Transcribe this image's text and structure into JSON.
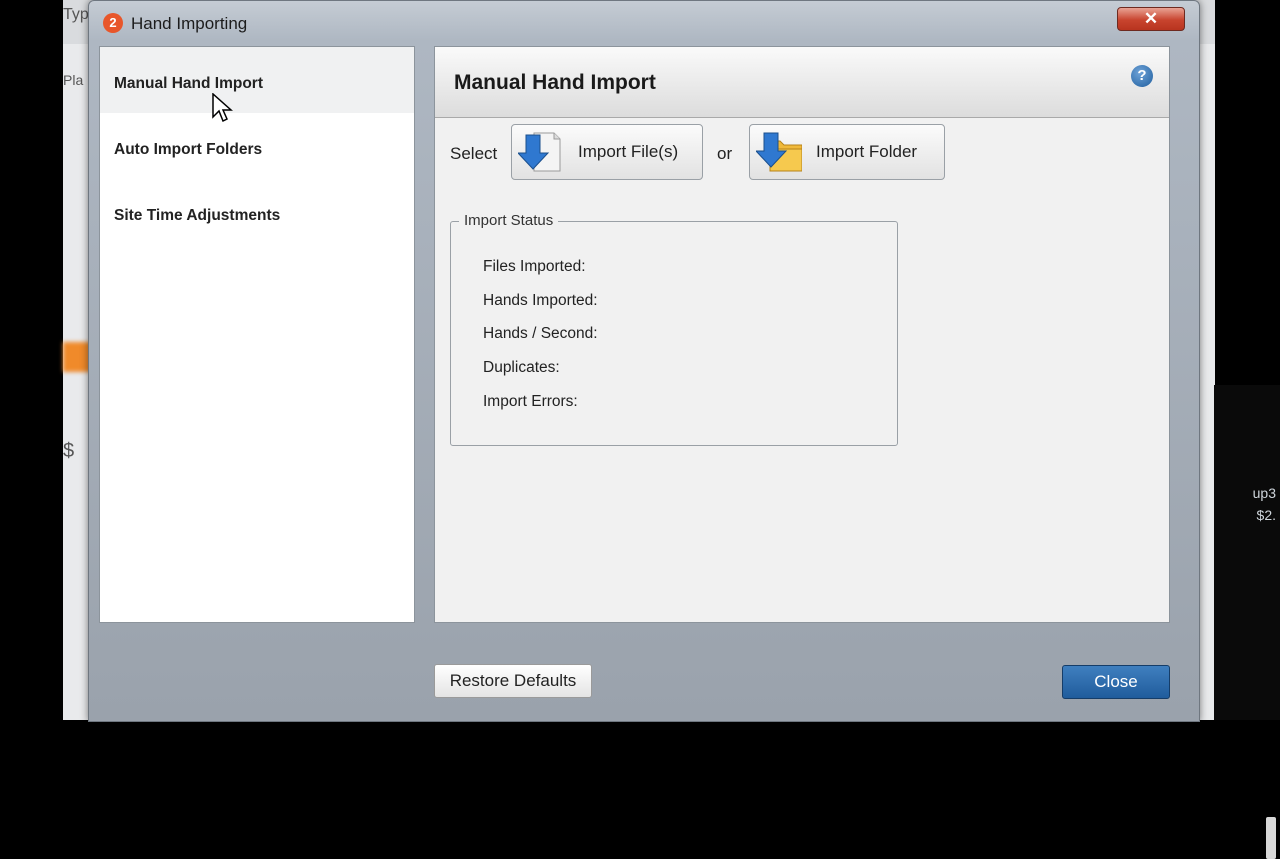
{
  "background": {
    "left_partial_1": "Typ",
    "left_partial_2": "Pla",
    "left_partial_3": "$",
    "right_partial_1": "up3",
    "right_partial_2": "$2."
  },
  "window": {
    "title": "Hand Importing",
    "app_icon_glyph": "2",
    "close_glyph": "✕"
  },
  "sidebar": {
    "items": [
      {
        "label": "Manual Hand Import",
        "active": true
      },
      {
        "label": "Auto Import Folders",
        "active": false
      },
      {
        "label": "Site Time Adjustments",
        "active": false
      }
    ]
  },
  "main": {
    "title": "Manual Hand Import",
    "help_glyph": "?",
    "select_label": "Select",
    "or_label": "or",
    "import_files_label": "Import File(s)",
    "import_folder_label": "Import Folder",
    "status": {
      "legend": "Import Status",
      "fields": [
        "Files Imported:",
        "Hands Imported:",
        "Hands / Second:",
        "Duplicates:",
        "Import Errors:"
      ]
    }
  },
  "footer": {
    "restore_label": "Restore Defaults",
    "close_label": "Close"
  },
  "colors": {
    "close_button": "#205c9c",
    "title_close": "#c8442e",
    "app_icon": "#e8562a",
    "help_icon": "#1f5e9e"
  }
}
